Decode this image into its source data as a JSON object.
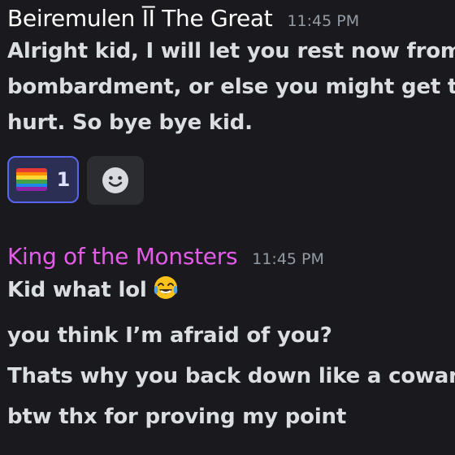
{
  "messages": [
    {
      "author": "Beiremulen ĪĪ The Great",
      "author_color": "#ffffff",
      "timestamp": "11:45 PM",
      "lines": [
        "Alright kid, I will let you rest now from",
        "bombardment, or else you might get to",
        "hurt. So bye bye kid."
      ],
      "reactions": [
        {
          "emoji": "rainbow-flag-icon",
          "count": "1",
          "selected": true
        }
      ],
      "add_reaction_icon": "smiley-add-reaction-icon"
    },
    {
      "author": "King of the Monsters",
      "author_color": "#e35ce8",
      "timestamp": "11:45 PM",
      "lines": [
        "Kid what lol",
        "you think I’m afraid of you?",
        "Thats why you back down like a coward",
        "btw thx for proving my point"
      ],
      "inline_emoji": "face-with-tears-of-joy-icon"
    }
  ],
  "colors": {
    "background": "#1a1a1e",
    "accent": "#5865f2",
    "timestamp": "#949ba4",
    "text": "#dbdee1"
  }
}
